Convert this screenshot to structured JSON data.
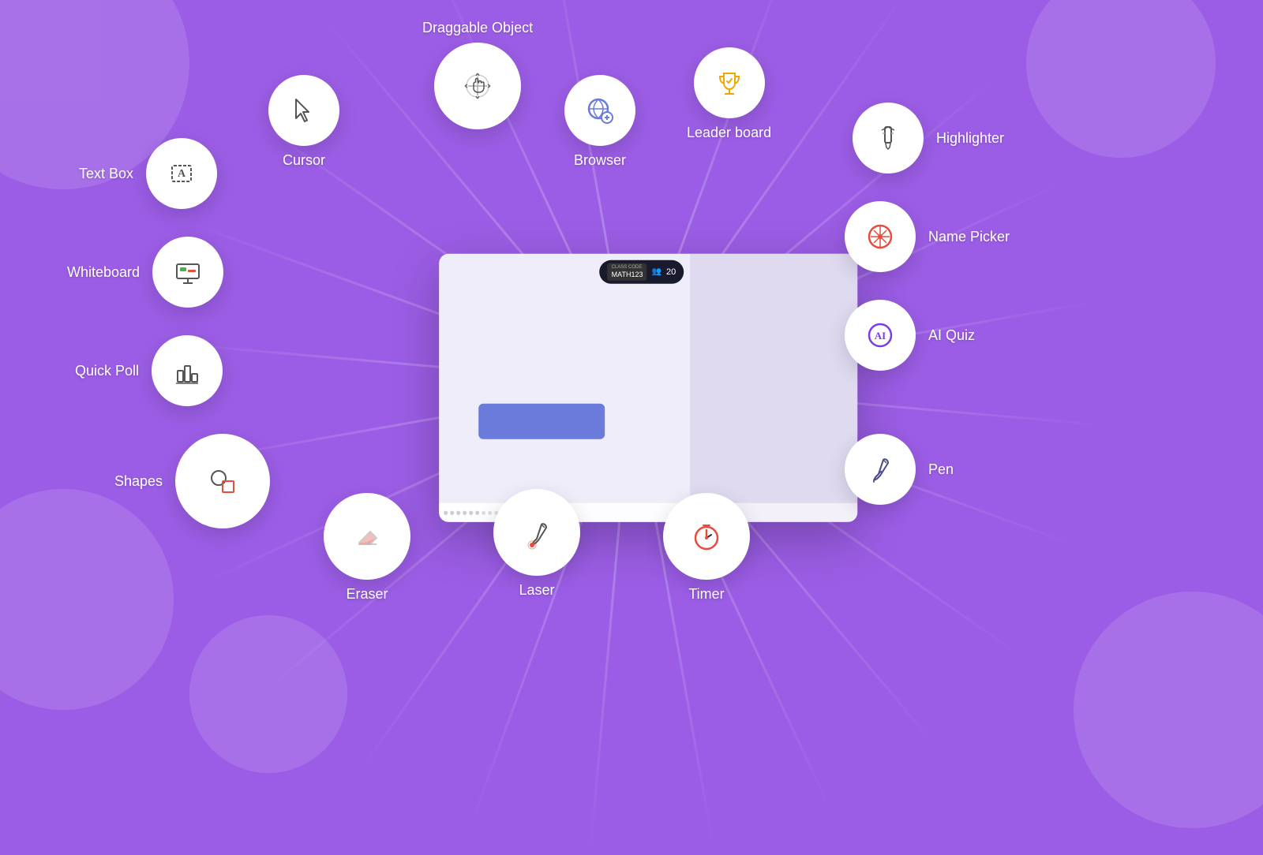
{
  "background_color": "#9b5de5",
  "accent_color": "#7c3aed",
  "features": {
    "cursor": {
      "label": "Cursor"
    },
    "draggable": {
      "label": "Draggable Object"
    },
    "browser": {
      "label": "Browser"
    },
    "leaderboard": {
      "label": "Leader board"
    },
    "highlighter": {
      "label": "Highlighter"
    },
    "namepicker": {
      "label": "Name Picker"
    },
    "aiquiz": {
      "label": "AI Quiz"
    },
    "pen": {
      "label": "Pen"
    },
    "textbox": {
      "label": "Text Box"
    },
    "whiteboard": {
      "label": "Whiteboard"
    },
    "quickpoll": {
      "label": "Quick Poll"
    },
    "shapes": {
      "label": "Shapes"
    },
    "eraser": {
      "label": "Eraser"
    },
    "laser": {
      "label": "Laser"
    },
    "timer": {
      "label": "Timer"
    }
  },
  "screen": {
    "class_code": "MATH123",
    "students_count": "20"
  }
}
